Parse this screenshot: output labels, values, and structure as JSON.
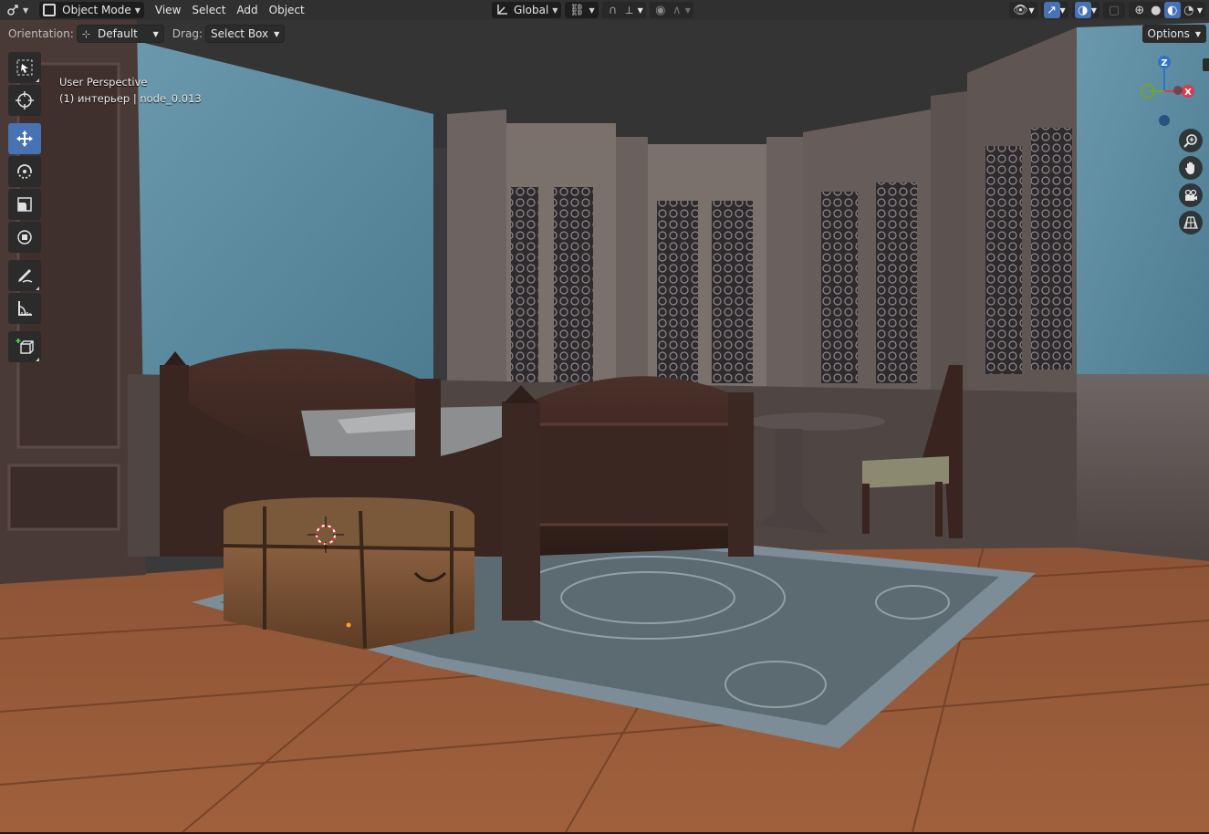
{
  "header": {
    "editor_icon": "editor-type-icon",
    "mode_label": "Object Mode",
    "menus": [
      "View",
      "Select",
      "Add",
      "Object"
    ],
    "transform_orientation": "Global"
  },
  "subheader": {
    "orientation_label": "Orientation:",
    "orientation_value": "Default",
    "drag_label": "Drag:",
    "drag_value": "Select Box",
    "options_label": "Options"
  },
  "viewport": {
    "perspective_label": "User Perspective",
    "object_label": "(1) интерьер | node_0.013"
  },
  "gizmo": {
    "z_label": "Z",
    "x_label": "X"
  },
  "tools": [
    {
      "name": "select-box-tool",
      "icon": "select-icon"
    },
    {
      "name": "cursor-tool",
      "icon": "cursor-icon"
    },
    {
      "name": "move-tool",
      "icon": "move-icon",
      "active": true
    },
    {
      "name": "rotate-tool",
      "icon": "rotate-icon"
    },
    {
      "name": "scale-tool",
      "icon": "scale-icon"
    },
    {
      "name": "transform-tool",
      "icon": "transform-icon"
    },
    {
      "name": "annotate-tool",
      "icon": "annotate-icon"
    },
    {
      "name": "measure-tool",
      "icon": "measure-icon"
    },
    {
      "name": "add-cube-tool",
      "icon": "add-cube-icon"
    }
  ],
  "colors": {
    "accent": "#4772b3",
    "axis_x": "#d43e4f",
    "axis_y": "#78a22c",
    "axis_z": "#2f73c8"
  }
}
